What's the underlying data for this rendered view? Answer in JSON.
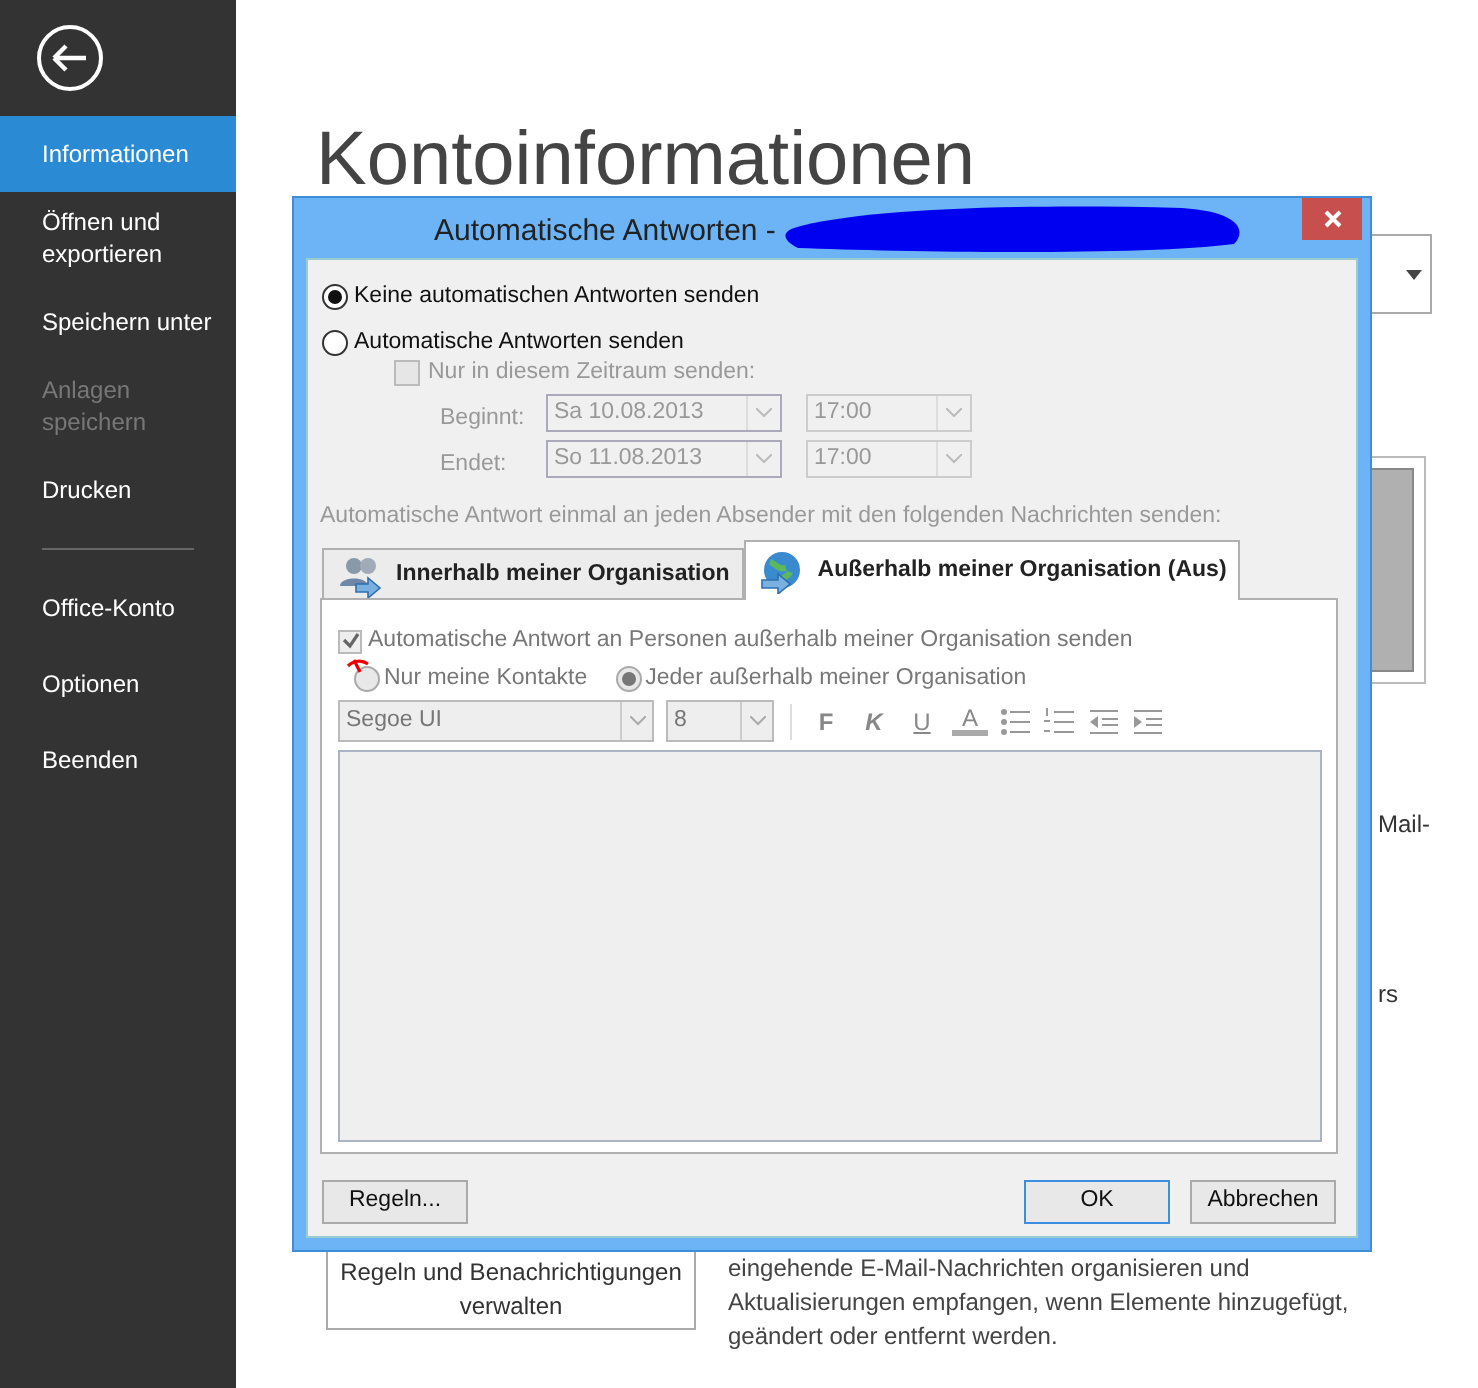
{
  "sidebar": {
    "items": [
      {
        "label": "Informationen",
        "selected": true,
        "disabled": false
      },
      {
        "label": "Öffnen und exportieren",
        "selected": false,
        "disabled": false
      },
      {
        "label": "Speichern unter",
        "selected": false,
        "disabled": false
      },
      {
        "label": "Anlagen speichern",
        "selected": false,
        "disabled": true
      },
      {
        "label": "Drucken",
        "selected": false,
        "disabled": false
      },
      {
        "label": "Office-Konto",
        "selected": false,
        "disabled": false
      },
      {
        "label": "Optionen",
        "selected": false,
        "disabled": false
      },
      {
        "label": "Beenden",
        "selected": false,
        "disabled": false
      }
    ]
  },
  "page": {
    "title": "Kontoinformationen",
    "text_fragments": [
      "Mail-",
      "rs"
    ],
    "rules_button": "Regeln und Benachrichtigungen verwalten",
    "description": "eingehende E-Mail-Nachrichten organisieren und Aktualisierungen empfangen, wenn Elemente hinzugefügt, geändert oder entfernt werden."
  },
  "dialog": {
    "title": "Automatische Antworten -",
    "reply_options": [
      {
        "label": "Keine automatischen Antworten senden",
        "selected": true
      },
      {
        "label": "Automatische Antworten senden",
        "selected": false
      }
    ],
    "date_range": {
      "label": "Nur in diesem Zeitraum senden:",
      "checked": false,
      "disabled": true,
      "rows": [
        {
          "label": "Beginnt:",
          "date": "Sa 10.08.2013",
          "time": "17:00"
        },
        {
          "label": "Endet:",
          "date": "So 11.08.2013",
          "time": "17:00"
        }
      ]
    },
    "caption": "Automatische Antwort einmal an jeden Absender mit den folgenden Nachrichten senden:",
    "tabs": [
      {
        "label": "Innerhalb meiner Organisation",
        "selected": false,
        "kind": "people"
      },
      {
        "label": "Außerhalb meiner Organisation (Aus)",
        "selected": true,
        "kind": "globe"
      }
    ],
    "external": {
      "label": "Automatische Antwort an Personen außerhalb meiner Organisation senden",
      "checked": true
    },
    "audience": [
      {
        "label": "Nur meine Kontakte",
        "selected": false
      },
      {
        "label": "Jeder außerhalb meiner Organisation",
        "selected": true
      }
    ],
    "font": "Segoe UI",
    "size": "8",
    "format_letters": [
      "F",
      "K",
      "U",
      "A"
    ],
    "buttons": [
      "Regeln...",
      "OK",
      "Abbrechen"
    ]
  }
}
